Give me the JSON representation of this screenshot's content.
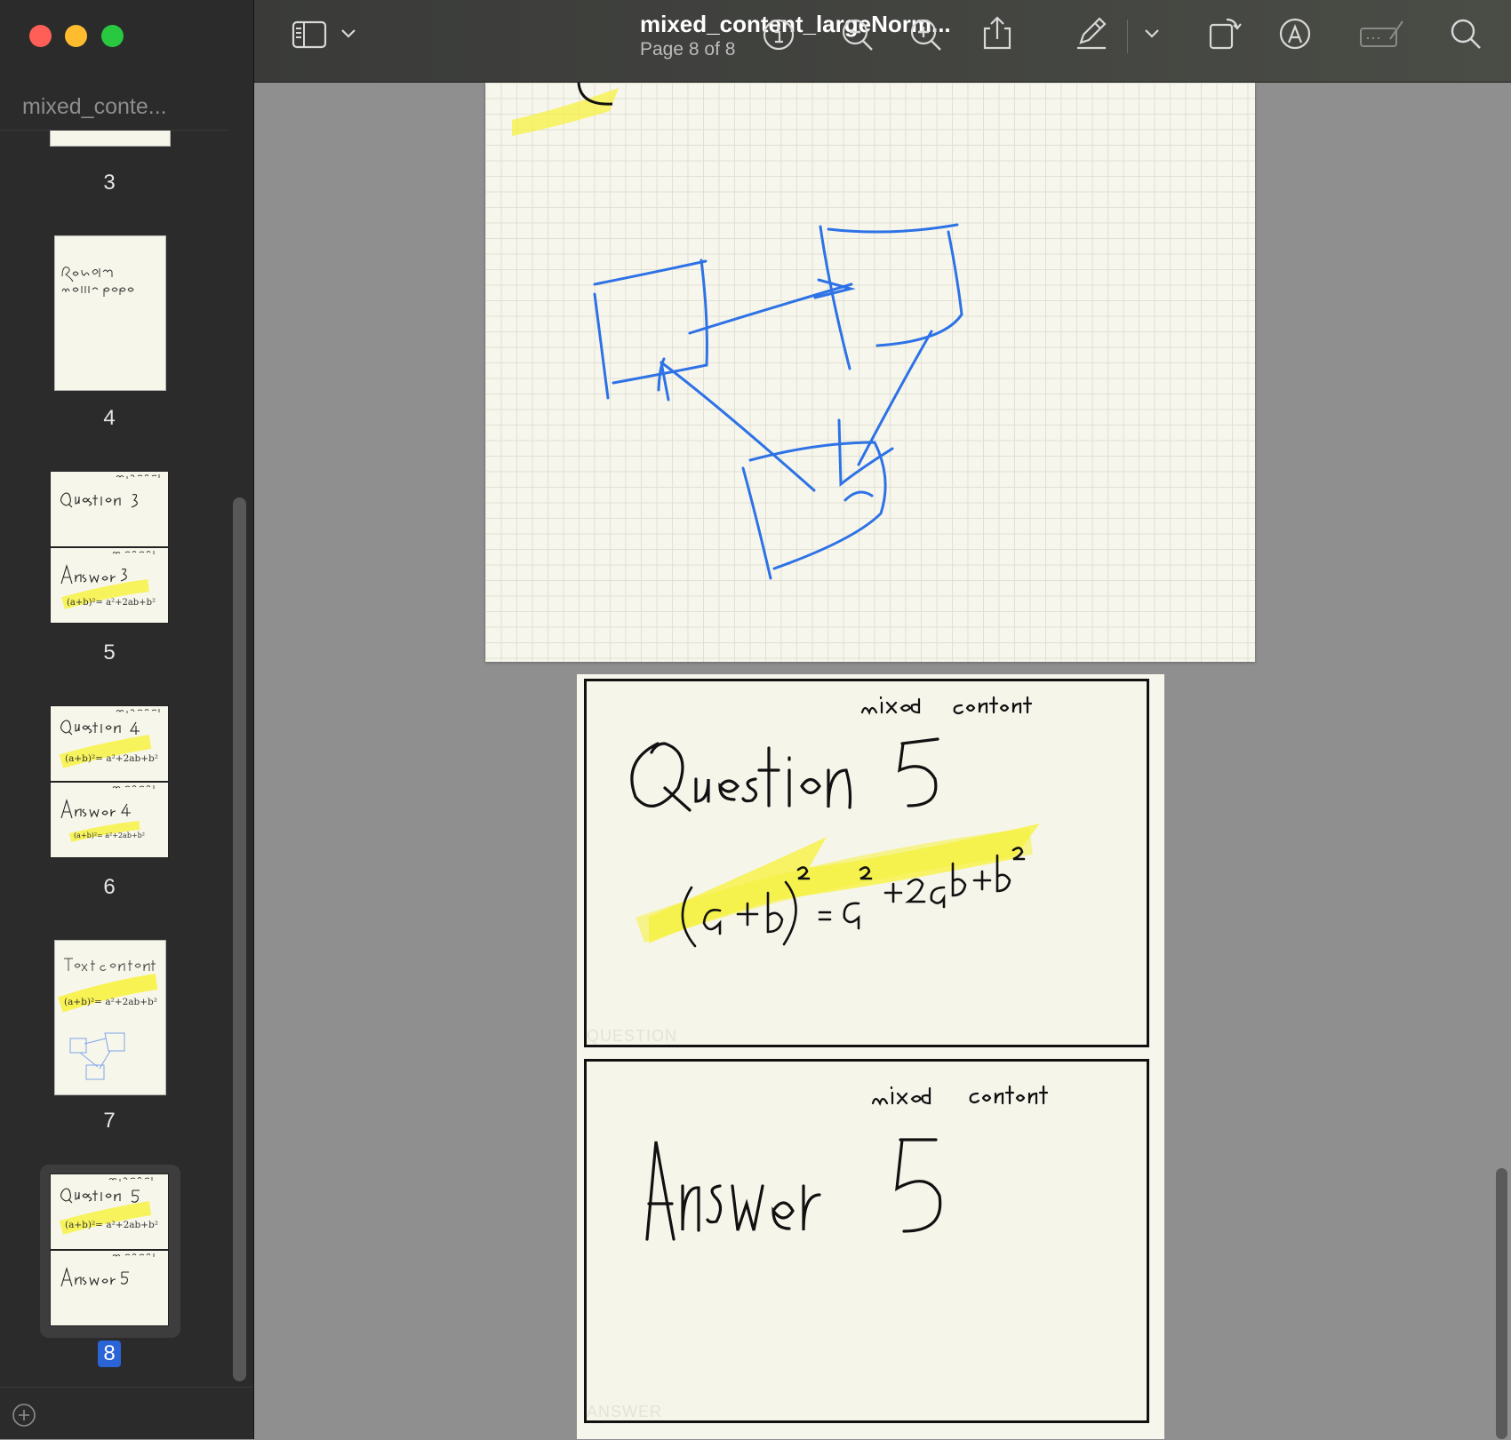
{
  "window": {
    "sidebar_title": "mixed_conte...",
    "doc_title": "mixed_content_largeNorm...",
    "page_indicator": "Page 8 of 8"
  },
  "toolbar": {
    "icons": [
      "sidebar-toggle-icon",
      "chevron-down-icon",
      "info-icon",
      "zoom-out-icon",
      "zoom-in-icon",
      "share-icon",
      "highlight-pen-icon",
      "chevron-down-icon",
      "rotate-icon",
      "markup-icon",
      "signature-icon",
      "search-icon"
    ]
  },
  "thumbnails": [
    {
      "page": "3"
    },
    {
      "page": "4",
      "text": "Random middle page"
    },
    {
      "page": "5",
      "top_text": "Question 3",
      "bottom_text": "Answer 3",
      "tag": "mixed content",
      "formula": "(a+b)² = a² + 2ab + b²"
    },
    {
      "page": "6",
      "top_text": "Question 4",
      "bottom_text": "Answer 4",
      "tag": "mixed content",
      "formula": "(a+b)² = a² + 2ab + b²"
    },
    {
      "page": "7",
      "top_text": "Text content",
      "formula": "(a+b)² = a² + 2ab + b²"
    },
    {
      "page": "8",
      "top_text": "Question 5",
      "bottom_text": "Answer 5",
      "tag": "mixed content",
      "formula": "(a+b)² = a² + 2ab + b²"
    }
  ],
  "selected_page": "8",
  "page8": {
    "question_tag": "mixed content",
    "question_title": "Question 5",
    "formula": "(a+b)² = a² + 2ab + b²",
    "question_label": "QUESTION",
    "answer_tag": "mixed content",
    "answer_title": "Answer 5",
    "answer_label": "ANSWER"
  },
  "colors": {
    "highlight": "#f7f243",
    "ink_blue": "#2d72e6",
    "selection": "#2a64d6"
  }
}
